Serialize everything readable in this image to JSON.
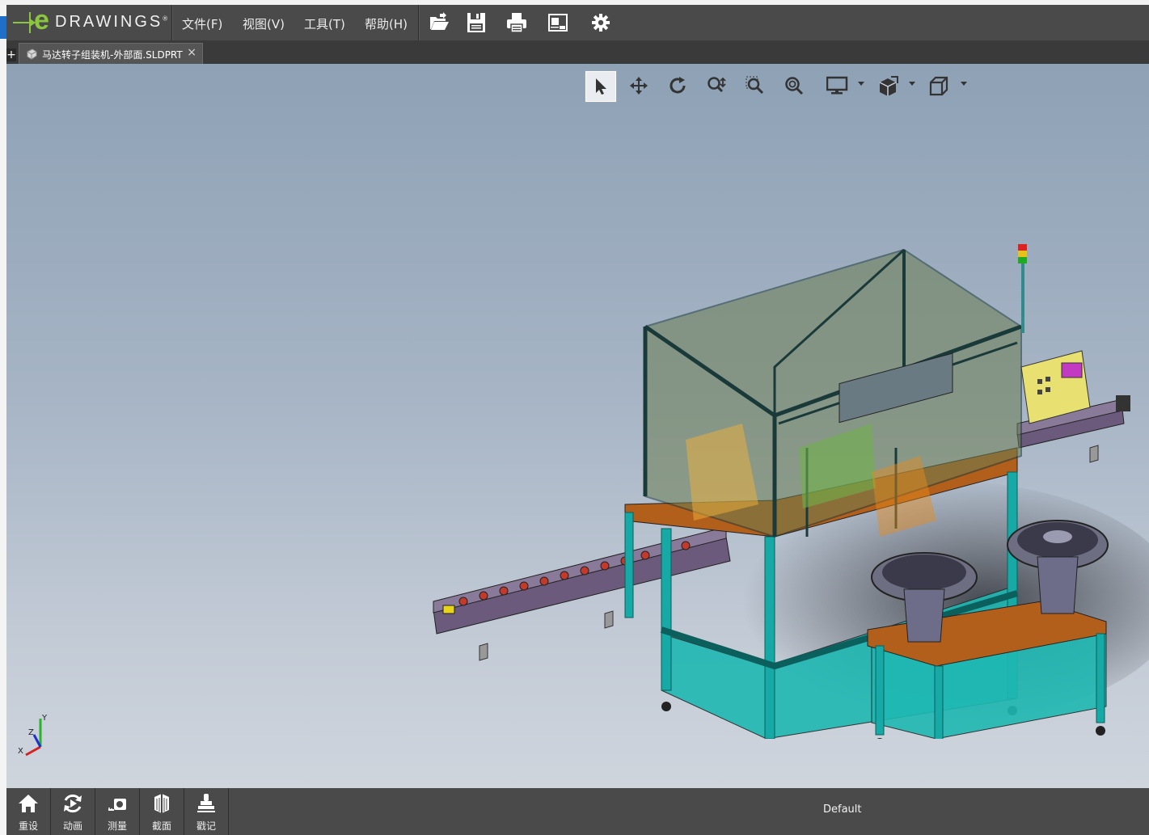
{
  "app": {
    "logo_letter": "e",
    "logo_word": "DRAWINGS",
    "logo_mark": "®"
  },
  "menu": {
    "file": "文件(F)",
    "view": "视图(V)",
    "tools": "工具(T)",
    "help": "帮助(H)"
  },
  "toolbar_icons": [
    "open-icon",
    "save-icon",
    "print-icon",
    "sheet-icon",
    "settings-icon"
  ],
  "tabs": [
    {
      "label": "马达转子组装机-外部面.SLDPRT",
      "close": "×"
    }
  ],
  "tab_add": "+",
  "view_tools": [
    "select-icon",
    "pan-icon",
    "rotate-icon",
    "zoom-icon",
    "zoom-to-area-icon",
    "zoom-to-fit-icon",
    "display-style-icon",
    "view-orientation-icon",
    "standard-view-icon"
  ],
  "triad": {
    "x": "X",
    "y": "Y",
    "z": "Z"
  },
  "bottom_buttons": [
    {
      "label": "重设",
      "icon": "home-icon"
    },
    {
      "label": "动画",
      "icon": "animate-icon"
    },
    {
      "label": "测量",
      "icon": "measure-icon"
    },
    {
      "label": "截面",
      "icon": "section-icon"
    },
    {
      "label": "戳记",
      "icon": "stamp-icon"
    }
  ],
  "status": {
    "configuration": "Default"
  },
  "colors": {
    "accent": "#8cc63f",
    "menubar": "#4a4a4a",
    "frame": "#17a9a5",
    "table": "#b35f1c"
  }
}
